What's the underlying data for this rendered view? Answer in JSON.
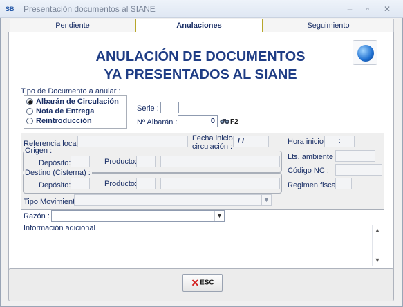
{
  "window": {
    "title": "Presentación documentos al SIANE",
    "icon_text": "SB"
  },
  "tabs": [
    {
      "label": "Pendiente"
    },
    {
      "label": "Anulaciones"
    },
    {
      "label": "Seguimiento"
    }
  ],
  "heading": {
    "line1": "ANULACIÓN DE DOCUMENTOS",
    "line2": "YA PRESENTADOS AL SIANE"
  },
  "doc_type": {
    "label": "Tipo de Documento a anular :",
    "options": [
      {
        "label": "Albarán de Circulación",
        "selected": true
      },
      {
        "label": "Nota de Entrega",
        "selected": false
      },
      {
        "label": "Reintroducción",
        "selected": false
      }
    ]
  },
  "serie": {
    "label": "Serie :",
    "value": ""
  },
  "albaran": {
    "label": "Nº Albarán :",
    "value": "0",
    "shortcut": "F2"
  },
  "details": {
    "ref_local_label": "Referencia local :",
    "fecha_label_1": "Fecha inicio",
    "fecha_label_2": "circulación :",
    "fecha_value": "/ /",
    "hora_label": "Hora inicio :",
    "hora_value": ":",
    "origen": {
      "legend": "Origen :",
      "deposito_label": "Depósito:",
      "producto_label": "Producto:"
    },
    "destino": {
      "legend": "Destino (Cisterna) :",
      "deposito_label": "Depósito:",
      "producto_label": "Producto:"
    },
    "lts_label": "Lts. ambiente :",
    "codigo_label": "Código NC :",
    "regimen_label": "Regimen fiscal :",
    "tipo_mov_label": "Tipo Movimiento :"
  },
  "razon": {
    "label": "Razón :",
    "value": ""
  },
  "info": {
    "label": "Información adicional :",
    "value": ""
  },
  "footer": {
    "esc_label": "ESC"
  }
}
